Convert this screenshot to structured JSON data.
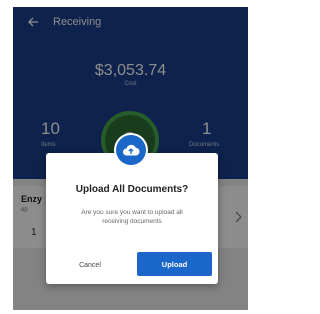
{
  "appbar": {
    "title": "Receiving"
  },
  "summary": {
    "amount": "$3,053.74",
    "amount_label": "Cost",
    "left_value": "10",
    "left_label": "Items",
    "right_value": "1",
    "right_label": "Documents"
  },
  "card": {
    "title": "Enzy",
    "subtitle": "ep",
    "number": "1"
  },
  "dialog": {
    "title": "Upload All Documents?",
    "message": "Are you sure you want to upload all receiving documents",
    "cancel_label": "Cancel",
    "upload_label": "Upload"
  },
  "colors": {
    "header": "#1b3f8c",
    "accent": "#1b66c9",
    "ring": "#47a84f"
  },
  "icons": [
    "back-arrow-icon",
    "cloud-upload-icon",
    "chevron-right-icon"
  ]
}
